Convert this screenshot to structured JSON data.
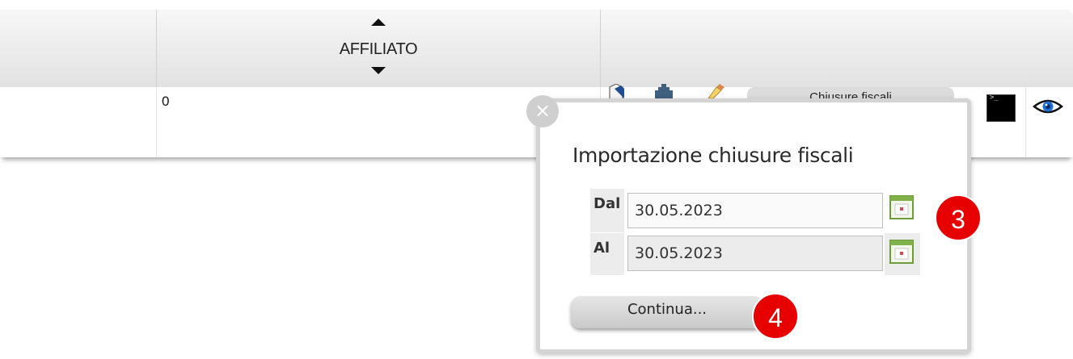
{
  "table": {
    "header": {
      "affiliato_label": "AFFILIATO"
    },
    "row": {
      "affiliato_value": "0",
      "fiscal_button_label": "Chiusure fiscali"
    }
  },
  "dialog": {
    "close_glyph": "×",
    "title": "Importazione chiusure fiscali",
    "from_label": "Dal",
    "from_value": "30.05.2023",
    "to_label": "Al",
    "to_value": "30.05.2023",
    "continue_label": "Continua..."
  },
  "annotations": {
    "step_3": "3",
    "step_4": "4"
  },
  "colors": {
    "badge": "#e60000",
    "header_bg": "#e8e8e8",
    "popup_border": "#d4d4d4"
  },
  "icons": [
    "document-icon",
    "gear-icon",
    "pencil-icon",
    "terminal-icon",
    "eye-icon",
    "calendar-icon",
    "close-icon",
    "sort-up-icon",
    "sort-down-icon"
  ]
}
